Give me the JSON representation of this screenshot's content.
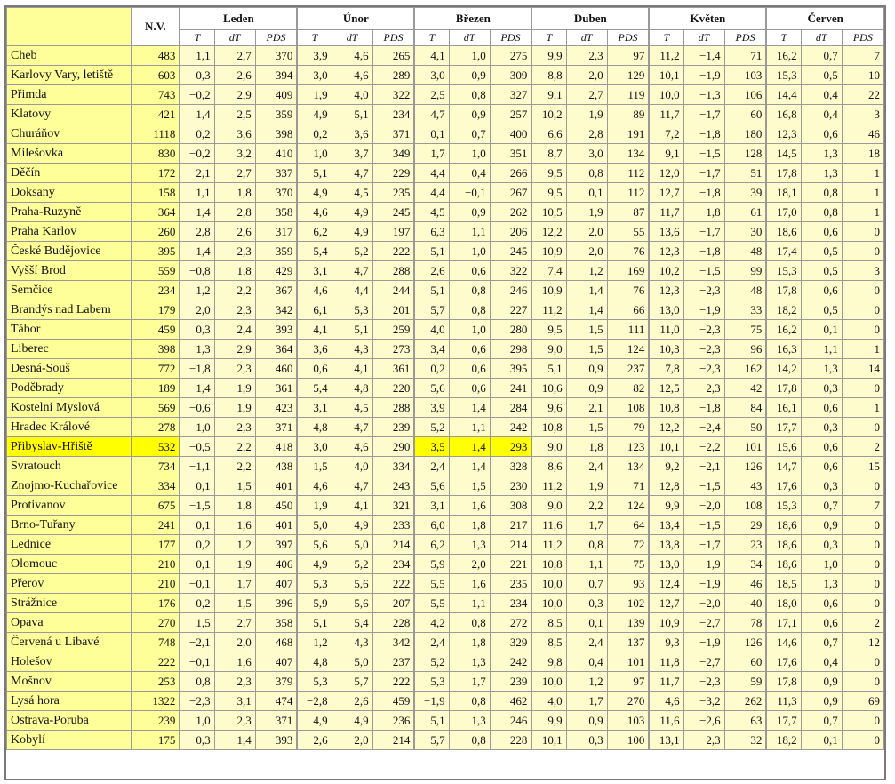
{
  "header": {
    "nv": "N.V.",
    "months": [
      "Leden",
      "Únor",
      "Březen",
      "Duben",
      "Květen",
      "Červen"
    ],
    "sub": [
      "T",
      "dT",
      "PDS"
    ]
  },
  "highlight": {
    "row": 20,
    "month": 2
  },
  "rows": [
    [
      "Cheb",
      "483",
      [
        "1,1",
        "2,7",
        "370"
      ],
      [
        "3,9",
        "4,6",
        "265"
      ],
      [
        "4,1",
        "1,0",
        "275"
      ],
      [
        "9,9",
        "2,3",
        "97"
      ],
      [
        "11,2",
        "−1,4",
        "71"
      ],
      [
        "16,2",
        "0,7",
        "7"
      ]
    ],
    [
      "Karlovy Vary, letiště",
      "603",
      [
        "0,3",
        "2,6",
        "394"
      ],
      [
        "3,0",
        "4,6",
        "289"
      ],
      [
        "3,0",
        "0,9",
        "309"
      ],
      [
        "8,8",
        "2,0",
        "129"
      ],
      [
        "10,1",
        "−1,9",
        "103"
      ],
      [
        "15,3",
        "0,5",
        "10"
      ]
    ],
    [
      "Přimda",
      "743",
      [
        "−0,2",
        "2,9",
        "409"
      ],
      [
        "1,9",
        "4,0",
        "322"
      ],
      [
        "2,5",
        "0,8",
        "327"
      ],
      [
        "9,1",
        "2,7",
        "119"
      ],
      [
        "10,0",
        "−1,3",
        "106"
      ],
      [
        "14,4",
        "0,4",
        "22"
      ]
    ],
    [
      "Klatovy",
      "421",
      [
        "1,4",
        "2,5",
        "359"
      ],
      [
        "4,9",
        "5,1",
        "234"
      ],
      [
        "4,7",
        "0,9",
        "257"
      ],
      [
        "10,2",
        "1,9",
        "89"
      ],
      [
        "11,7",
        "−1,7",
        "60"
      ],
      [
        "16,8",
        "0,4",
        "3"
      ]
    ],
    [
      "Churáňov",
      "1118",
      [
        "0,2",
        "3,6",
        "398"
      ],
      [
        "0,2",
        "3,6",
        "371"
      ],
      [
        "0,1",
        "0,7",
        "400"
      ],
      [
        "6,6",
        "2,8",
        "191"
      ],
      [
        "7,2",
        "−1,8",
        "180"
      ],
      [
        "12,3",
        "0,6",
        "46"
      ]
    ],
    [
      "Milešovka",
      "830",
      [
        "−0,2",
        "3,2",
        "410"
      ],
      [
        "1,0",
        "3,7",
        "349"
      ],
      [
        "1,7",
        "1,0",
        "351"
      ],
      [
        "8,7",
        "3,0",
        "134"
      ],
      [
        "9,1",
        "−1,5",
        "128"
      ],
      [
        "14,5",
        "1,3",
        "18"
      ]
    ],
    [
      "Děčín",
      "172",
      [
        "2,1",
        "2,7",
        "337"
      ],
      [
        "5,1",
        "4,7",
        "229"
      ],
      [
        "4,4",
        "0,4",
        "266"
      ],
      [
        "9,5",
        "0,8",
        "112"
      ],
      [
        "12,0",
        "−1,7",
        "51"
      ],
      [
        "17,8",
        "1,3",
        "1"
      ]
    ],
    [
      "Doksany",
      "158",
      [
        "1,1",
        "1,8",
        "370"
      ],
      [
        "4,9",
        "4,5",
        "235"
      ],
      [
        "4,4",
        "−0,1",
        "267"
      ],
      [
        "9,5",
        "0,1",
        "112"
      ],
      [
        "12,7",
        "−1,8",
        "39"
      ],
      [
        "18,1",
        "0,8",
        "1"
      ]
    ],
    [
      "Praha-Ruzyně",
      "364",
      [
        "1,4",
        "2,8",
        "358"
      ],
      [
        "4,6",
        "4,9",
        "245"
      ],
      [
        "4,5",
        "0,9",
        "262"
      ],
      [
        "10,5",
        "1,9",
        "87"
      ],
      [
        "11,7",
        "−1,8",
        "61"
      ],
      [
        "17,0",
        "0,8",
        "1"
      ]
    ],
    [
      "Praha Karlov",
      "260",
      [
        "2,8",
        "2,6",
        "317"
      ],
      [
        "6,2",
        "4,9",
        "197"
      ],
      [
        "6,3",
        "1,1",
        "206"
      ],
      [
        "12,2",
        "2,0",
        "55"
      ],
      [
        "13,6",
        "−1,7",
        "30"
      ],
      [
        "18,6",
        "0,6",
        "0"
      ]
    ],
    [
      "České Budějovice",
      "395",
      [
        "1,4",
        "2,3",
        "359"
      ],
      [
        "5,4",
        "5,2",
        "222"
      ],
      [
        "5,1",
        "1,0",
        "245"
      ],
      [
        "10,9",
        "2,0",
        "76"
      ],
      [
        "12,3",
        "−1,8",
        "48"
      ],
      [
        "17,4",
        "0,5",
        "0"
      ]
    ],
    [
      "Vyšší Brod",
      "559",
      [
        "−0,8",
        "1,8",
        "429"
      ],
      [
        "3,1",
        "4,7",
        "288"
      ],
      [
        "2,6",
        "0,6",
        "322"
      ],
      [
        "7,4",
        "1,2",
        "169"
      ],
      [
        "10,2",
        "−1,5",
        "99"
      ],
      [
        "15,3",
        "0,5",
        "3"
      ]
    ],
    [
      "Semčice",
      "234",
      [
        "1,2",
        "2,2",
        "367"
      ],
      [
        "4,6",
        "4,4",
        "244"
      ],
      [
        "5,1",
        "0,8",
        "246"
      ],
      [
        "10,9",
        "1,4",
        "76"
      ],
      [
        "12,3",
        "−2,3",
        "48"
      ],
      [
        "17,8",
        "0,6",
        "0"
      ]
    ],
    [
      "Brandýs nad Labem",
      "179",
      [
        "2,0",
        "2,3",
        "342"
      ],
      [
        "6,1",
        "5,3",
        "201"
      ],
      [
        "5,7",
        "0,8",
        "227"
      ],
      [
        "11,2",
        "1,4",
        "66"
      ],
      [
        "13,0",
        "−1,9",
        "33"
      ],
      [
        "18,2",
        "0,5",
        "0"
      ]
    ],
    [
      "Tábor",
      "459",
      [
        "0,3",
        "2,4",
        "393"
      ],
      [
        "4,1",
        "5,1",
        "259"
      ],
      [
        "4,0",
        "1,0",
        "280"
      ],
      [
        "9,5",
        "1,5",
        "111"
      ],
      [
        "11,0",
        "−2,3",
        "75"
      ],
      [
        "16,2",
        "0,1",
        "0"
      ]
    ],
    [
      "Liberec",
      "398",
      [
        "1,3",
        "2,9",
        "364"
      ],
      [
        "3,6",
        "4,3",
        "273"
      ],
      [
        "3,4",
        "0,6",
        "298"
      ],
      [
        "9,0",
        "1,5",
        "124"
      ],
      [
        "10,3",
        "−2,3",
        "96"
      ],
      [
        "16,3",
        "1,1",
        "1"
      ]
    ],
    [
      "Desná-Souš",
      "772",
      [
        "−1,8",
        "2,3",
        "460"
      ],
      [
        "0,6",
        "4,1",
        "361"
      ],
      [
        "0,2",
        "0,6",
        "395"
      ],
      [
        "5,1",
        "0,9",
        "237"
      ],
      [
        "7,8",
        "−2,3",
        "162"
      ],
      [
        "14,2",
        "1,3",
        "14"
      ]
    ],
    [
      "Poděbrady",
      "189",
      [
        "1,4",
        "1,9",
        "361"
      ],
      [
        "5,4",
        "4,8",
        "220"
      ],
      [
        "5,6",
        "0,6",
        "241"
      ],
      [
        "10,6",
        "0,9",
        "82"
      ],
      [
        "12,5",
        "−2,3",
        "42"
      ],
      [
        "17,8",
        "0,3",
        "0"
      ]
    ],
    [
      "Kostelní Myslová",
      "569",
      [
        "−0,6",
        "1,9",
        "423"
      ],
      [
        "3,1",
        "4,5",
        "288"
      ],
      [
        "3,9",
        "1,4",
        "284"
      ],
      [
        "9,6",
        "2,1",
        "108"
      ],
      [
        "10,8",
        "−1,8",
        "84"
      ],
      [
        "16,1",
        "0,6",
        "1"
      ]
    ],
    [
      "Hradec Králové",
      "278",
      [
        "1,0",
        "2,3",
        "371"
      ],
      [
        "4,8",
        "4,7",
        "239"
      ],
      [
        "5,2",
        "1,1",
        "242"
      ],
      [
        "10,8",
        "1,5",
        "79"
      ],
      [
        "12,2",
        "−2,4",
        "50"
      ],
      [
        "17,7",
        "0,3",
        "0"
      ]
    ],
    [
      "Přibyslav-Hřiště",
      "532",
      [
        "−0,5",
        "2,2",
        "418"
      ],
      [
        "3,0",
        "4,6",
        "290"
      ],
      [
        "3,5",
        "1,4",
        "293"
      ],
      [
        "9,0",
        "1,8",
        "123"
      ],
      [
        "10,1",
        "−2,2",
        "101"
      ],
      [
        "15,6",
        "0,6",
        "2"
      ]
    ],
    [
      "Svratouch",
      "734",
      [
        "−1,1",
        "2,2",
        "438"
      ],
      [
        "1,5",
        "4,0",
        "334"
      ],
      [
        "2,4",
        "1,4",
        "328"
      ],
      [
        "8,6",
        "2,4",
        "134"
      ],
      [
        "9,2",
        "−2,1",
        "126"
      ],
      [
        "14,7",
        "0,6",
        "15"
      ]
    ],
    [
      "Znojmo-Kuchařovice",
      "334",
      [
        "0,1",
        "1,5",
        "401"
      ],
      [
        "4,6",
        "4,7",
        "243"
      ],
      [
        "5,6",
        "1,5",
        "230"
      ],
      [
        "11,2",
        "1,9",
        "71"
      ],
      [
        "12,8",
        "−1,5",
        "43"
      ],
      [
        "17,6",
        "0,3",
        "0"
      ]
    ],
    [
      "Protivanov",
      "675",
      [
        "−1,5",
        "1,8",
        "450"
      ],
      [
        "1,9",
        "4,1",
        "321"
      ],
      [
        "3,1",
        "1,6",
        "308"
      ],
      [
        "9,0",
        "2,2",
        "124"
      ],
      [
        "9,9",
        "−2,0",
        "108"
      ],
      [
        "15,3",
        "0,7",
        "7"
      ]
    ],
    [
      "Brno-Tuřany",
      "241",
      [
        "0,1",
        "1,6",
        "401"
      ],
      [
        "5,0",
        "4,9",
        "233"
      ],
      [
        "6,0",
        "1,8",
        "217"
      ],
      [
        "11,6",
        "1,7",
        "64"
      ],
      [
        "13,4",
        "−1,5",
        "29"
      ],
      [
        "18,6",
        "0,9",
        "0"
      ]
    ],
    [
      "Lednice",
      "177",
      [
        "0,2",
        "1,2",
        "397"
      ],
      [
        "5,6",
        "5,0",
        "214"
      ],
      [
        "6,2",
        "1,3",
        "214"
      ],
      [
        "11,2",
        "0,8",
        "72"
      ],
      [
        "13,8",
        "−1,7",
        "23"
      ],
      [
        "18,6",
        "0,3",
        "0"
      ]
    ],
    [
      "Olomouc",
      "210",
      [
        "−0,1",
        "1,9",
        "406"
      ],
      [
        "4,9",
        "5,2",
        "234"
      ],
      [
        "5,9",
        "2,0",
        "221"
      ],
      [
        "10,8",
        "1,1",
        "75"
      ],
      [
        "13,0",
        "−1,9",
        "34"
      ],
      [
        "18,6",
        "1,0",
        "0"
      ]
    ],
    [
      "Přerov",
      "210",
      [
        "−0,1",
        "1,7",
        "407"
      ],
      [
        "5,3",
        "5,6",
        "222"
      ],
      [
        "5,5",
        "1,6",
        "235"
      ],
      [
        "10,0",
        "0,7",
        "93"
      ],
      [
        "12,4",
        "−1,9",
        "46"
      ],
      [
        "18,5",
        "1,3",
        "0"
      ]
    ],
    [
      "Strážnice",
      "176",
      [
        "0,2",
        "1,5",
        "396"
      ],
      [
        "5,9",
        "5,6",
        "207"
      ],
      [
        "5,5",
        "1,1",
        "234"
      ],
      [
        "10,0",
        "0,3",
        "102"
      ],
      [
        "12,7",
        "−2,0",
        "40"
      ],
      [
        "18,0",
        "0,6",
        "0"
      ]
    ],
    [
      "Opava",
      "270",
      [
        "1,5",
        "2,7",
        "358"
      ],
      [
        "5,1",
        "5,4",
        "228"
      ],
      [
        "4,2",
        "0,8",
        "272"
      ],
      [
        "8,5",
        "0,1",
        "139"
      ],
      [
        "10,9",
        "−2,7",
        "78"
      ],
      [
        "17,1",
        "0,6",
        "2"
      ]
    ],
    [
      "Červená u Libavé",
      "748",
      [
        "−2,1",
        "2,0",
        "468"
      ],
      [
        "1,2",
        "4,3",
        "342"
      ],
      [
        "2,4",
        "1,8",
        "329"
      ],
      [
        "8,5",
        "2,4",
        "137"
      ],
      [
        "9,3",
        "−1,9",
        "126"
      ],
      [
        "14,6",
        "0,7",
        "12"
      ]
    ],
    [
      "Holešov",
      "222",
      [
        "−0,1",
        "1,6",
        "407"
      ],
      [
        "4,8",
        "5,0",
        "237"
      ],
      [
        "5,2",
        "1,3",
        "242"
      ],
      [
        "9,8",
        "0,4",
        "101"
      ],
      [
        "11,8",
        "−2,7",
        "60"
      ],
      [
        "17,6",
        "0,4",
        "0"
      ]
    ],
    [
      "Mošnov",
      "253",
      [
        "0,8",
        "2,3",
        "379"
      ],
      [
        "5,3",
        "5,7",
        "222"
      ],
      [
        "5,3",
        "1,7",
        "239"
      ],
      [
        "10,0",
        "1,2",
        "97"
      ],
      [
        "11,7",
        "−2,3",
        "59"
      ],
      [
        "17,8",
        "0,9",
        "0"
      ]
    ],
    [
      "Lysá hora",
      "1322",
      [
        "−2,3",
        "3,1",
        "474"
      ],
      [
        "−2,8",
        "2,6",
        "459"
      ],
      [
        "−1,9",
        "0,8",
        "462"
      ],
      [
        "4,0",
        "1,7",
        "270"
      ],
      [
        "4,6",
        "−3,2",
        "262"
      ],
      [
        "11,3",
        "0,9",
        "69"
      ]
    ],
    [
      "Ostrava-Poruba",
      "239",
      [
        "1,0",
        "2,3",
        "371"
      ],
      [
        "4,9",
        "4,9",
        "236"
      ],
      [
        "5,1",
        "1,3",
        "246"
      ],
      [
        "9,9",
        "0,9",
        "103"
      ],
      [
        "11,6",
        "−2,6",
        "63"
      ],
      [
        "17,7",
        "0,7",
        "0"
      ]
    ],
    [
      "Kobylí",
      "175",
      [
        "0,3",
        "1,4",
        "393"
      ],
      [
        "2,6",
        "2,0",
        "214"
      ],
      [
        "5,7",
        "0,8",
        "228"
      ],
      [
        "10,1",
        "−0,3",
        "100"
      ],
      [
        "13,1",
        "−2,3",
        "32"
      ],
      [
        "18,2",
        "0,1",
        "0"
      ]
    ]
  ]
}
